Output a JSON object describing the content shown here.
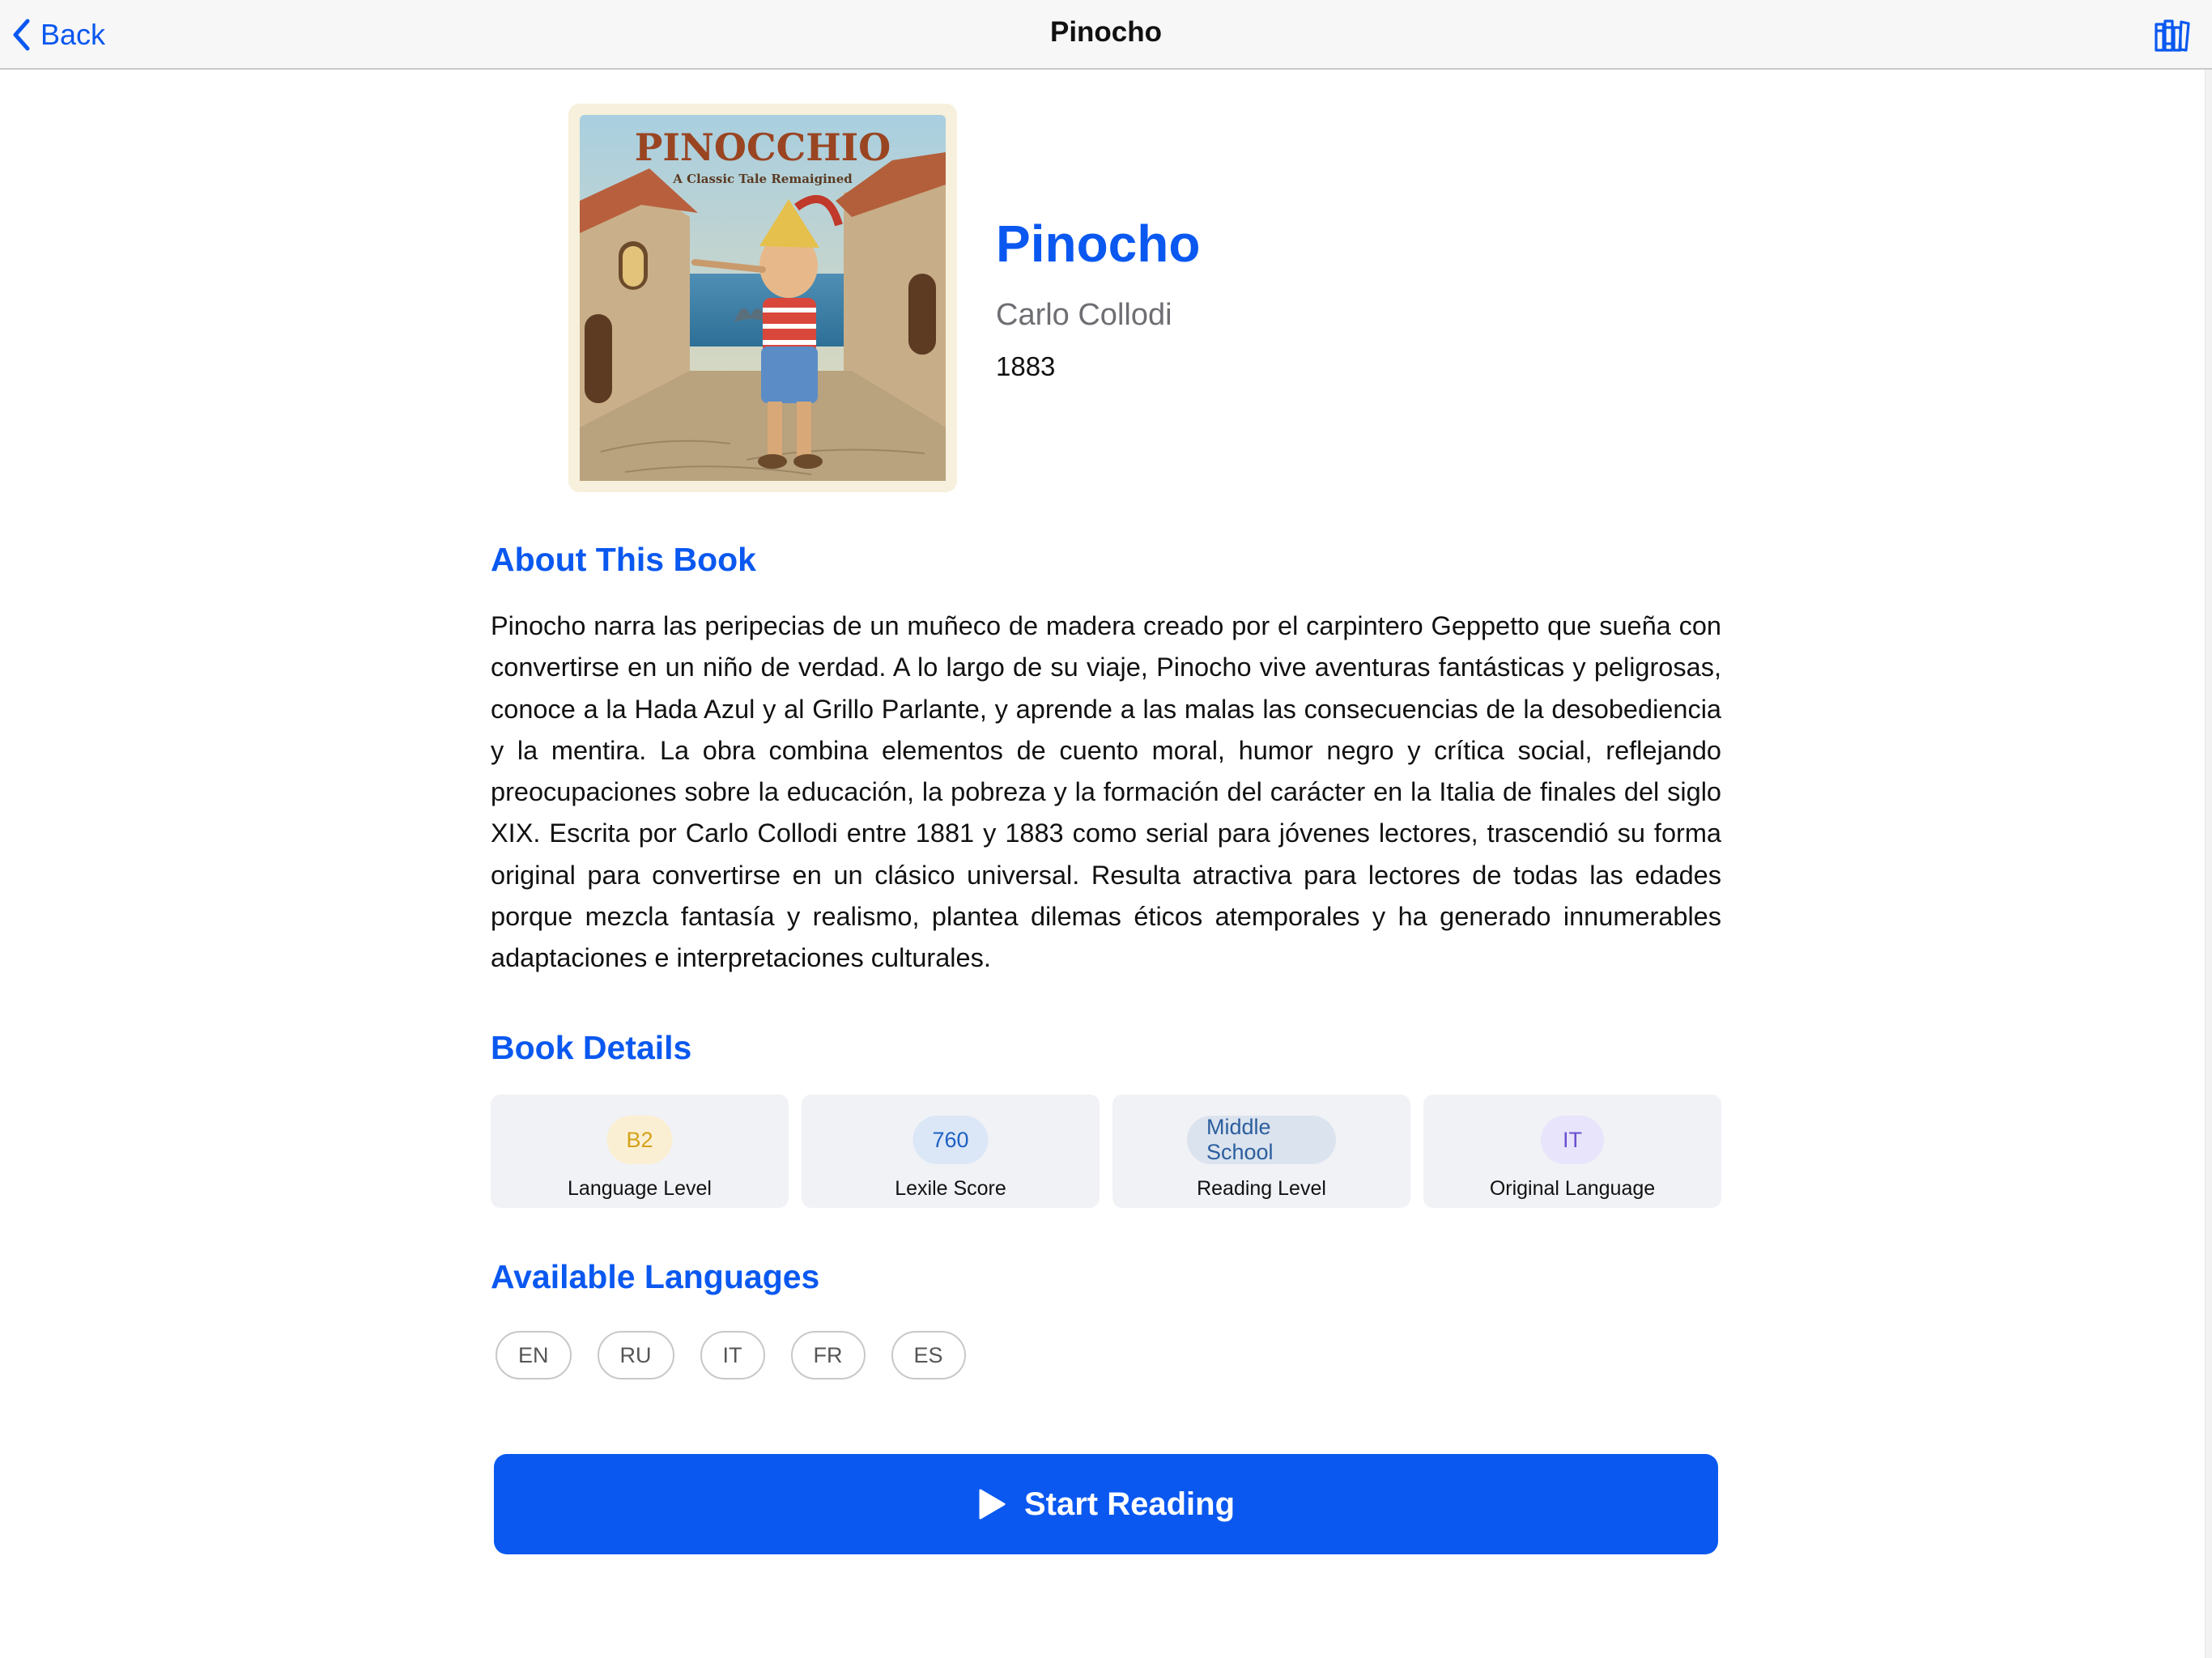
{
  "nav": {
    "back_label": "Back",
    "title": "Pinocho",
    "back_icon": "chevron-left-icon",
    "library_icon": "books-icon"
  },
  "book": {
    "title": "Pinocho",
    "author": "Carlo Collodi",
    "year": "1883",
    "cover": {
      "title_text": "PINOCCHIO",
      "subtitle_text": "A Classic Tale Remaigined"
    }
  },
  "about": {
    "heading": "About This Book",
    "description": "Pinocho narra las peripecias de un muñeco de madera creado por el carpintero Geppetto que sueña con convertirse en un niño de verdad. A lo largo de su viaje, Pinocho vive aventuras fantásticas y peligrosas, conoce a la Hada Azul y al Grillo Parlante, y aprende a las malas las consecuencias de la desobediencia y la mentira. La obra combina elementos de cuento moral, humor negro y crítica social, reflejando preocupaciones sobre la educación, la pobreza y la formación del carácter en la Italia de finales del siglo XIX. Escrita por Carlo Collodi entre 1881 y 1883 como serial para jóvenes lectores, trascendió su forma original para convertirse en un clásico universal. Resulta atractiva para lectores de todas las edades porque mezcla fantasía y realismo, plantea dilemas éticos atemporales y ha generado innumerables adaptaciones e interpretaciones culturales."
  },
  "details": {
    "heading": "Book Details",
    "cards": [
      {
        "value": "B2",
        "label": "Language Level",
        "color": "#d4a21a"
      },
      {
        "value": "760",
        "label": "Lexile Score",
        "color": "#1d5fc4"
      },
      {
        "value": "Middle School",
        "label": "Reading Level",
        "color": "#2b5e9e"
      },
      {
        "value": "IT",
        "label": "Original Language",
        "color": "#6a4ed1"
      }
    ]
  },
  "languages": {
    "heading": "Available Languages",
    "items": [
      "EN",
      "RU",
      "IT",
      "FR",
      "ES"
    ]
  },
  "cta": {
    "label": "Start Reading",
    "icon": "play-icon"
  },
  "colors": {
    "accent": "#0a58f0",
    "nav_background": "#f7f7f8"
  }
}
